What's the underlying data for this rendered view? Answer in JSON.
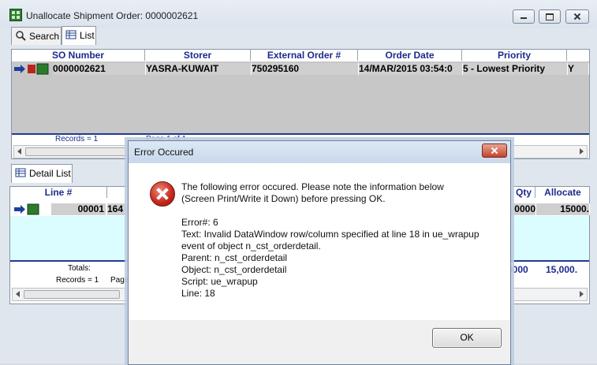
{
  "window": {
    "title": "Unallocate Shipment Order: 0000002621"
  },
  "top_tabs": [
    {
      "label": "Search"
    },
    {
      "label": "List"
    }
  ],
  "list_grid": {
    "columns": [
      "SO Number",
      "Storer",
      "External Order #",
      "Order Date",
      "Priority"
    ],
    "row": {
      "so_number": "0000002621",
      "storer": "YASRA-KUWAIT",
      "external_order": "750295160",
      "order_date": "14/MAR/2015 03:54:0",
      "priority": "5 - Lowest Priority",
      "overflow": "Y"
    },
    "footer_records": "Records = 1",
    "footer_page": "Page 1 of 1"
  },
  "detail_tab": {
    "label": "Detail List"
  },
  "detail_grid": {
    "columns": {
      "line": "Line #",
      "qty": "Qty",
      "allocate": "Allocate"
    },
    "row": {
      "line": "00001",
      "partial": "164",
      "qty": "0000",
      "allocate": "15000."
    },
    "totals_label": "Totals:",
    "totals_qty": "0000",
    "totals_allocate": "15,000.",
    "records": "Records = 1",
    "page": "Page"
  },
  "dialog": {
    "title": "Error Occured",
    "line1": "The following error occured.  Please note the information below",
    "line2": " (Screen Print/Write it Down) before pressing OK.",
    "error_no": "Error#: 6",
    "text1": "Text: Invalid DataWindow row/column specified at line 18 in ue_wrapup",
    "text2": "event of object n_cst_orderdetail.",
    "parent": "Parent: n_cst_orderdetail",
    "object": "Object: n_cst_orderdetail",
    "script": "Script: ue_wrapup",
    "line": "Line: 18",
    "ok_label": "OK"
  }
}
